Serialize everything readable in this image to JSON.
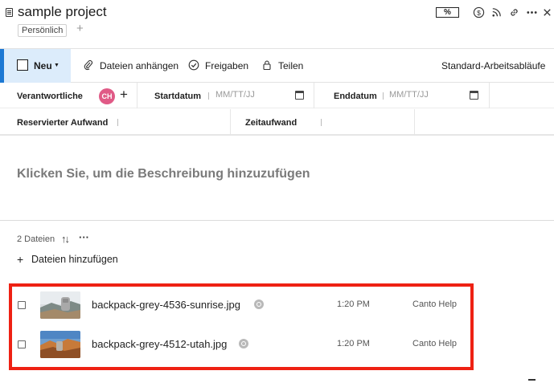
{
  "window": {
    "title": "sample project",
    "tag": "Persönlich",
    "top_icons": [
      "percent-box-icon",
      "dollar-icon",
      "rss-icon",
      "link-icon",
      "more-icon",
      "close-icon"
    ],
    "percent_label": "%"
  },
  "toolbar": {
    "new_label": "Neu",
    "attach_label": "Dateien anhängen",
    "approvals_label": "Freigaben",
    "share_label": "Teilen",
    "workflows_label": "Standard-Arbeitsabläufe"
  },
  "fields": {
    "responsible_label": "Verantwortliche",
    "responsible_avatar": "CH",
    "start_label": "Startdatum",
    "start_placeholder": "MM/TT/JJ",
    "end_label": "Enddatum",
    "end_placeholder": "MM/TT/JJ",
    "reserved_label": "Reservierter Aufwand",
    "time_label": "Zeitaufwand"
  },
  "description": {
    "placeholder": "Klicken Sie, um die Beschreibung hinzuzufügen"
  },
  "files": {
    "count_label": "2 Dateien",
    "add_label": "Dateien hinzufügen",
    "items": [
      {
        "name": "backpack-grey-4536-sunrise.jpg",
        "time": "1:20 PM",
        "source": "Canto Help"
      },
      {
        "name": "backpack-grey-4512-utah.jpg",
        "time": "1:20 PM",
        "source": "Canto Help"
      }
    ]
  },
  "colors": {
    "accent": "#1c78d3",
    "new_button_bg": "#dcecfb",
    "avatar": "#e05a86",
    "highlight": "#ee2113"
  }
}
